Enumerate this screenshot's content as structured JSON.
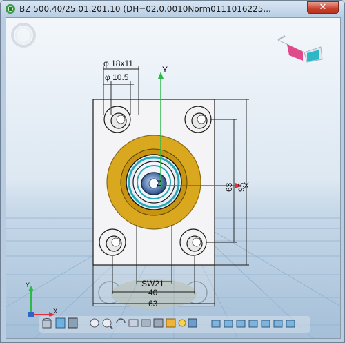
{
  "window": {
    "title": "BZ 500.40/25.01.201.10 (DH=02.0.0010Norm0111016225...",
    "close_glyph": "✕"
  },
  "viewport": {
    "axes": {
      "y": "Y",
      "x": "X",
      "z": "Z"
    },
    "dimensions": {
      "hole_counterbore": "φ 18x11",
      "hole_diameter": "φ 10.5",
      "height_inner": "63",
      "height_outer": "95",
      "width_flats": "SW21",
      "width_inner": "40",
      "width_outer": "63"
    },
    "mini_axes": {
      "y": "Y",
      "x": "X"
    }
  },
  "toolbar": {
    "items": [
      "cylinder-icon",
      "cube-icon",
      "cube-dark-icon",
      "zoom-extents-icon",
      "zoom-icon",
      "rotate-icon",
      "pan-icon",
      "measure-icon",
      "section-icon",
      "render-icon",
      "light-icon",
      "shaded-icon",
      "view-iso-icon",
      "view-front-icon",
      "view-back-icon",
      "view-left-icon",
      "view-right-icon",
      "view-top-icon",
      "view-bottom-icon"
    ]
  },
  "colors": {
    "flange": "#d9a81f",
    "plate": "#f4f4f6",
    "axis_x": "#e0303a",
    "axis_y": "#2db84a",
    "sky_top": "#eef5fb",
    "floor": "#a9c3dc"
  }
}
